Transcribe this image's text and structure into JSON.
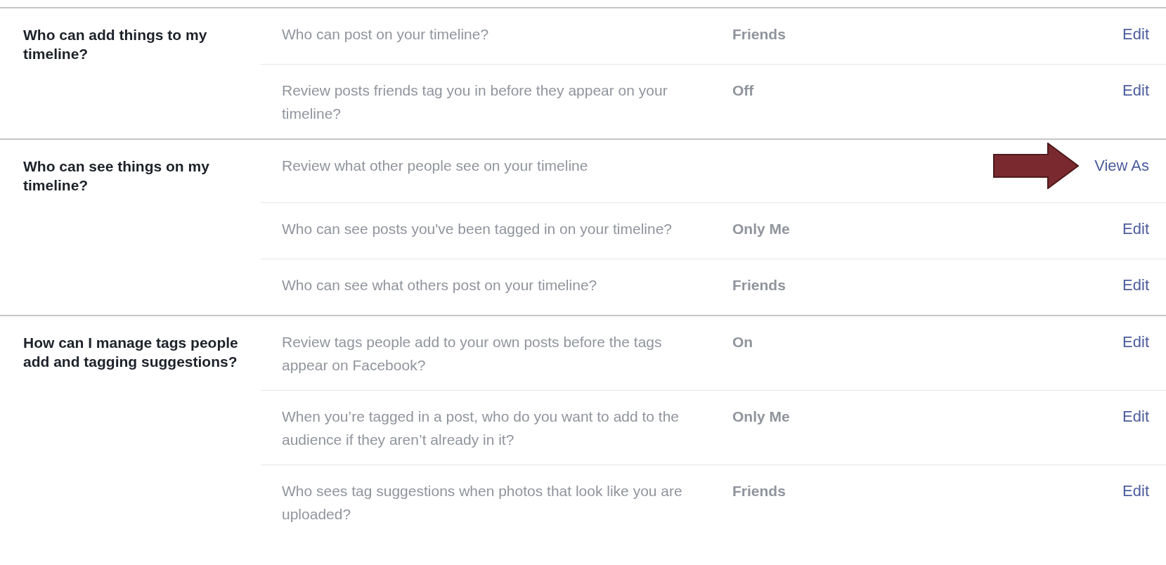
{
  "sections": [
    {
      "heading": "Who can add things to my timeline?",
      "rows": [
        {
          "question": "Who can post on your timeline?",
          "value": "Friends",
          "action": "Edit",
          "highlighted": false
        },
        {
          "question": "Review posts friends tag you in before they appear on your timeline?",
          "value": "Off",
          "action": "Edit",
          "highlighted": false
        }
      ]
    },
    {
      "heading": "Who can see things on my timeline?",
      "rows": [
        {
          "question": "Review what other people see on your timeline",
          "action": "View As",
          "highlighted": true
        },
        {
          "question": "Who can see posts you've been tagged in on your timeline?",
          "value": "Only Me",
          "action": "Edit",
          "highlighted": false
        },
        {
          "question": "Who can see what others post on your timeline?",
          "value": "Friends",
          "action": "Edit",
          "highlighted": false
        }
      ]
    },
    {
      "heading": "How can I manage tags people add and tagging suggestions?",
      "rows": [
        {
          "question": "Review tags people add to your own posts before the tags appear on Facebook?",
          "value": "On",
          "action": "Edit",
          "highlighted": false
        },
        {
          "question": "When you’re tagged in a post, who do you want to add to the audience if they aren’t already in it?",
          "value": "Only Me",
          "action": "Edit",
          "highlighted": false
        },
        {
          "question": "Who sees tag suggestions when photos that look like you are uploaded?",
          "value": "Friends",
          "action": "Edit",
          "highlighted": false
        }
      ]
    }
  ]
}
